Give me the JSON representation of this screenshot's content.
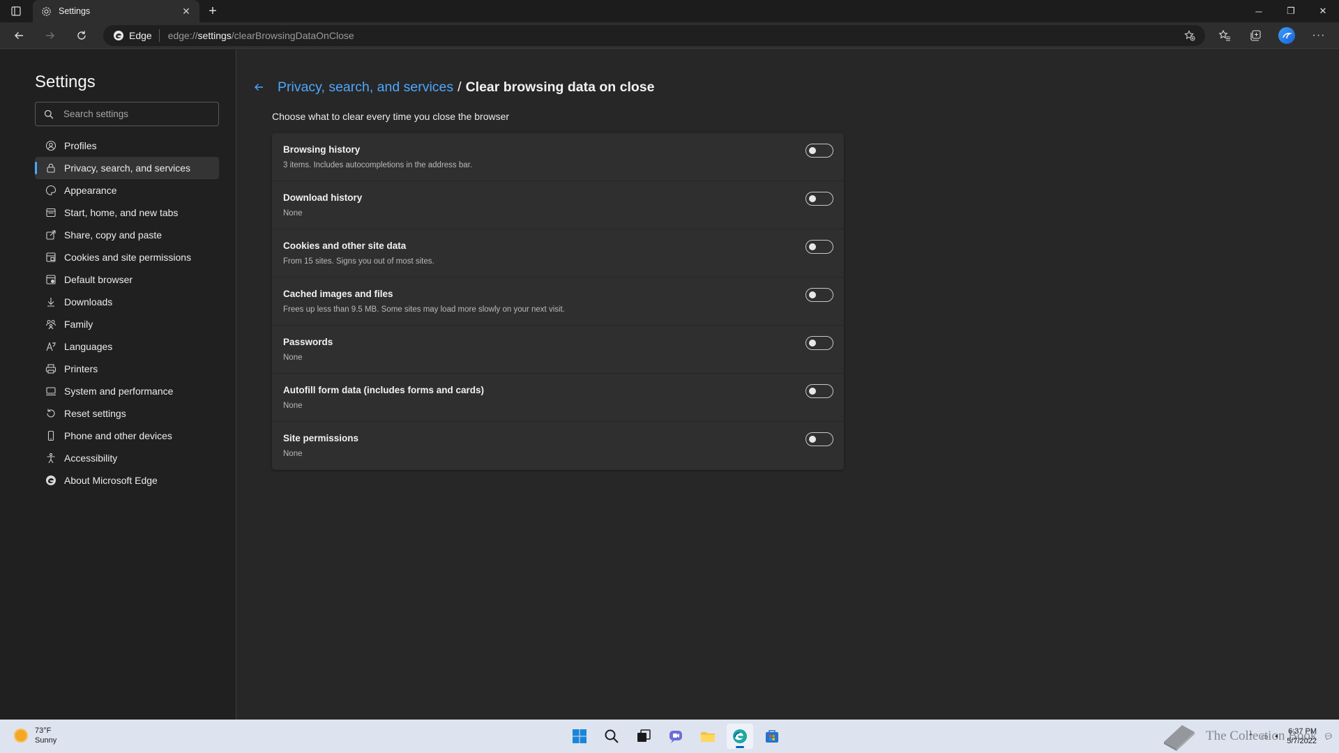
{
  "browser": {
    "tab_title": "Settings",
    "site_label": "Edge",
    "url_prefix": "edge://",
    "url_host": "settings",
    "url_path": "/clearBrowsingDataOnClose"
  },
  "sidebar": {
    "title": "Settings",
    "search_placeholder": "Search settings",
    "items": [
      {
        "label": "Profiles",
        "icon": "profile-icon"
      },
      {
        "label": "Privacy, search, and services",
        "icon": "lock-icon",
        "active": true
      },
      {
        "label": "Appearance",
        "icon": "appearance-icon"
      },
      {
        "label": "Start, home, and new tabs",
        "icon": "start-tabs-icon"
      },
      {
        "label": "Share, copy and paste",
        "icon": "share-icon"
      },
      {
        "label": "Cookies and site permissions",
        "icon": "cookies-icon"
      },
      {
        "label": "Default browser",
        "icon": "default-browser-icon"
      },
      {
        "label": "Downloads",
        "icon": "download-icon"
      },
      {
        "label": "Family",
        "icon": "family-icon"
      },
      {
        "label": "Languages",
        "icon": "languages-icon"
      },
      {
        "label": "Printers",
        "icon": "printer-icon"
      },
      {
        "label": "System and performance",
        "icon": "system-icon"
      },
      {
        "label": "Reset settings",
        "icon": "reset-icon"
      },
      {
        "label": "Phone and other devices",
        "icon": "phone-icon"
      },
      {
        "label": "Accessibility",
        "icon": "accessibility-icon"
      },
      {
        "label": "About Microsoft Edge",
        "icon": "edge-icon"
      }
    ]
  },
  "main": {
    "breadcrumb_parent": "Privacy, search, and services",
    "breadcrumb_sep": "/",
    "breadcrumb_current": "Clear browsing data on close",
    "intro": "Choose what to clear every time you close the browser",
    "options": [
      {
        "title": "Browsing history",
        "desc": "3 items. Includes autocompletions in the address bar.",
        "enabled": false
      },
      {
        "title": "Download history",
        "desc": "None",
        "enabled": false
      },
      {
        "title": "Cookies and other site data",
        "desc": "From 15 sites. Signs you out of most sites.",
        "enabled": false
      },
      {
        "title": "Cached images and files",
        "desc": "Frees up less than 9.5 MB. Some sites may load more slowly on your next visit.",
        "enabled": false
      },
      {
        "title": "Passwords",
        "desc": "None",
        "enabled": false
      },
      {
        "title": "Autofill form data (includes forms and cards)",
        "desc": "None",
        "enabled": false
      },
      {
        "title": "Site permissions",
        "desc": "None",
        "enabled": false
      }
    ]
  },
  "taskbar": {
    "temperature": "73°F",
    "condition": "Sunny",
    "time": "6:37 PM",
    "date": "5/7/2022",
    "watermark": "The Collection Book"
  },
  "colors": {
    "accent": "#4ea7ff",
    "background": "#272727",
    "sidebar": "#202020",
    "card": "#2f2f2f"
  }
}
